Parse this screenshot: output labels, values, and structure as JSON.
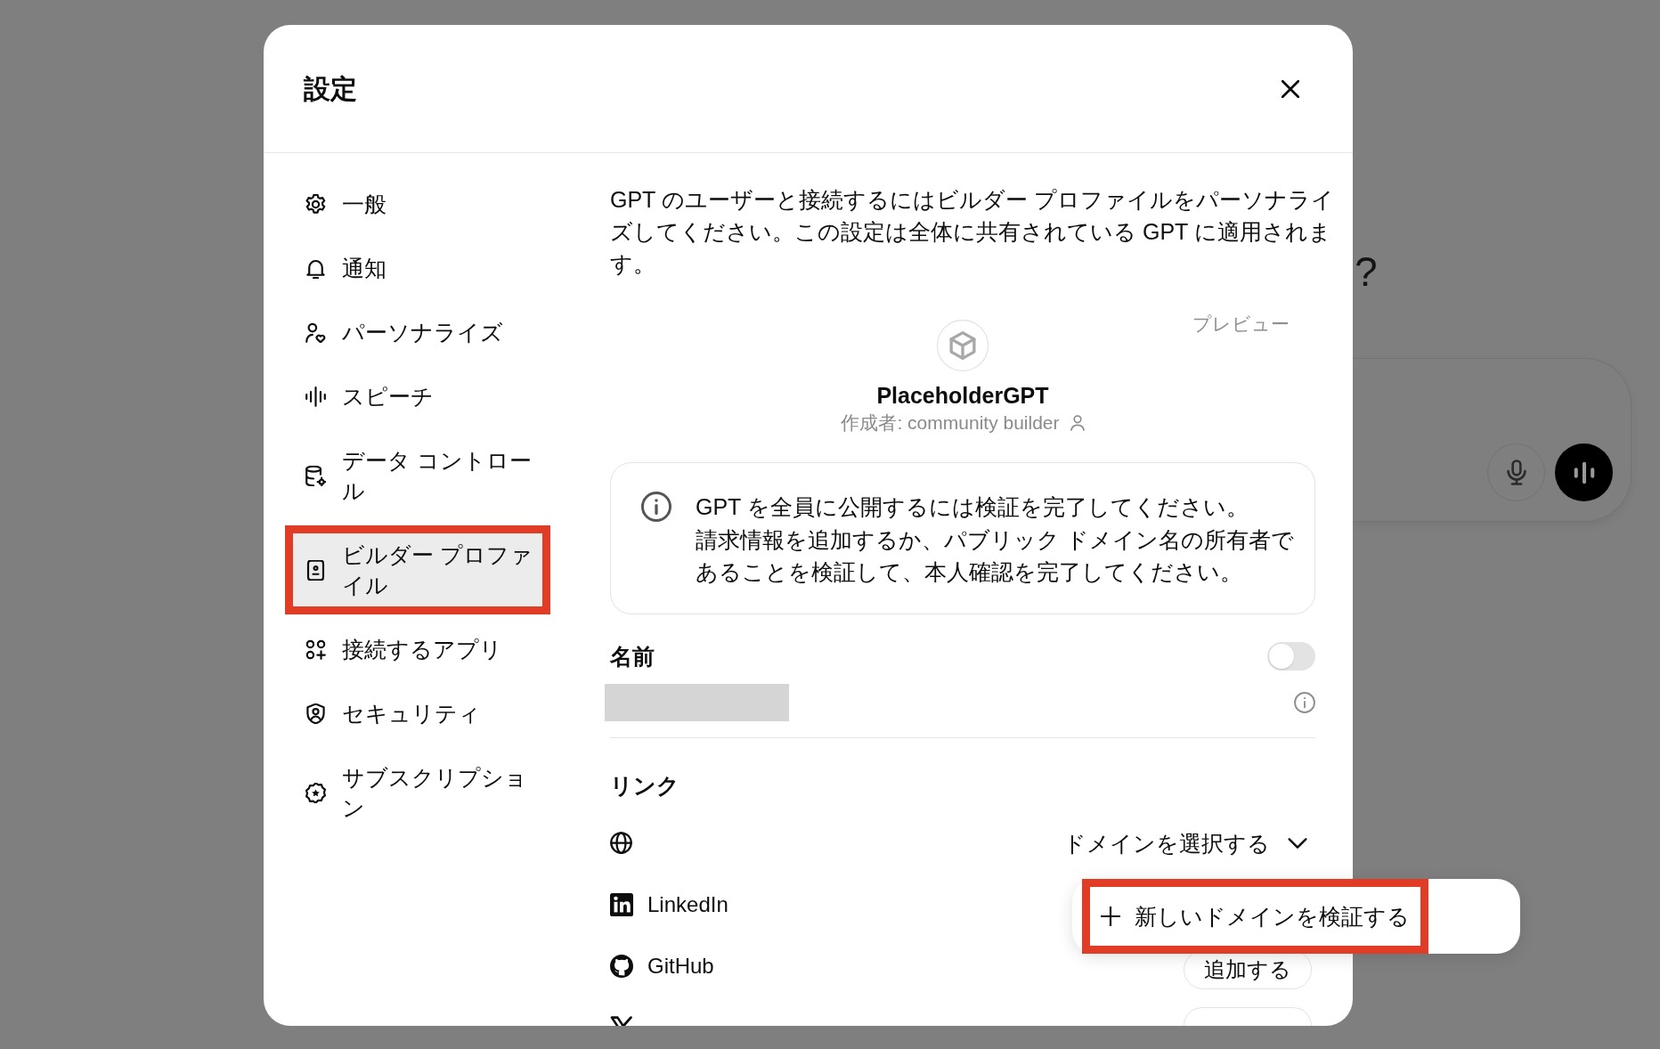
{
  "backdrop": {
    "heading_fragment": "?"
  },
  "dialog": {
    "title": "設定"
  },
  "sidebar": {
    "items": [
      {
        "label": "一般",
        "selected": false,
        "annotated": false
      },
      {
        "label": "通知",
        "selected": false,
        "annotated": false
      },
      {
        "label": "パーソナライズ",
        "selected": false,
        "annotated": false
      },
      {
        "label": "スピーチ",
        "selected": false,
        "annotated": false
      },
      {
        "label": "データ コントロール",
        "selected": false,
        "annotated": false
      },
      {
        "label": "ビルダー プロファイル",
        "selected": true,
        "annotated": true
      },
      {
        "label": "接続するアプリ",
        "selected": false,
        "annotated": false
      },
      {
        "label": "セキュリティ",
        "selected": false,
        "annotated": false
      },
      {
        "label": "サブスクリプション",
        "selected": false,
        "annotated": false
      }
    ]
  },
  "builder_profile": {
    "intro": "GPT のユーザーと接続するにはビルダー プロファイルをパーソナライズしてください。この設定は全体に共有されている GPT に適用されます。",
    "preview": {
      "label": "プレビュー",
      "name": "PlaceholderGPT",
      "author": "作成者: community builder"
    },
    "notice": {
      "lines": [
        "GPT を全員に公開するには検証を完了してください。",
        "請求情報を追加するか、パブリック ドメイン名の所有者であることを検証して、本人確認を完了してください。"
      ]
    },
    "name_field": {
      "label": "名前",
      "on": false
    },
    "links": {
      "heading": "リンク",
      "domain_select": {
        "label": "ドメインを選択する",
        "expanded": true,
        "menu": [
          {
            "label": "新しいドメインを検証する",
            "annotated": true
          }
        ]
      },
      "accounts": [
        {
          "kind": "linkedin",
          "label": "LinkedIn",
          "button": false
        },
        {
          "kind": "github",
          "label": "GitHub",
          "button": true,
          "action": "追加する"
        },
        {
          "kind": "x",
          "button": true
        }
      ]
    }
  }
}
